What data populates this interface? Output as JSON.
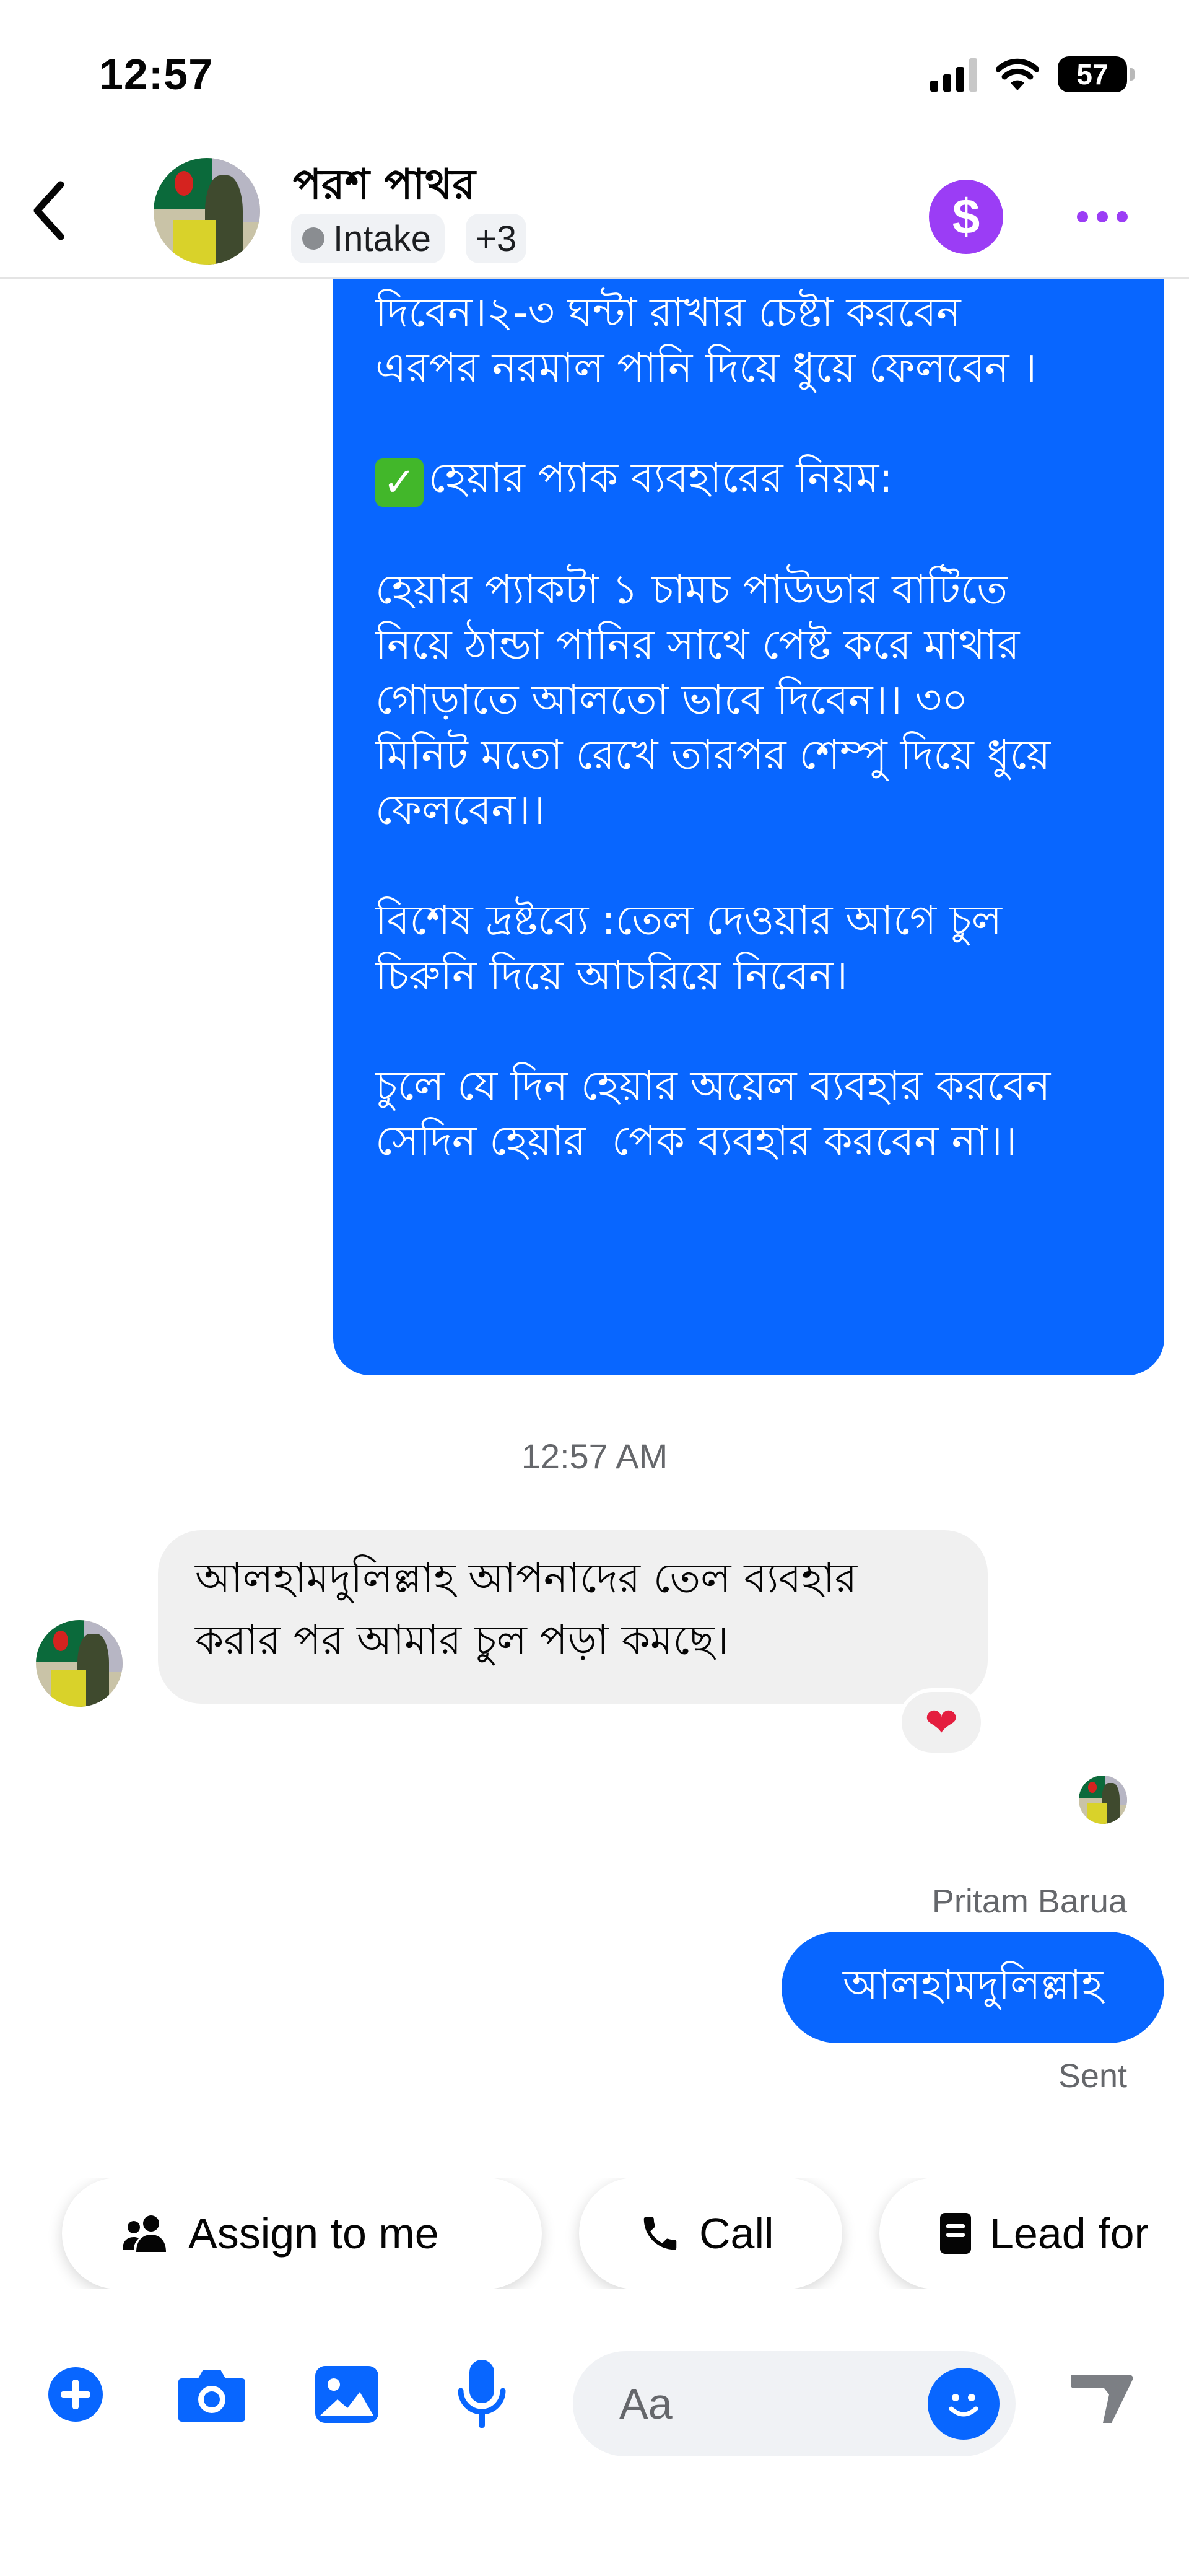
{
  "status_bar": {
    "time": "12:57",
    "battery": "57"
  },
  "header": {
    "contact_name": "পরশ পাথর",
    "label": "Intake",
    "more_labels": "+3",
    "payment_icon_glyph": "$"
  },
  "messages": {
    "outgoing_long_lines": [
      "দিবেন।২-৩ ঘন্টা রাখার চেষ্টা করবেন",
      "এরপর নরমাল পানি দিয়ে ধুয়ে ফেলবেন ।",
      "",
      "হেয়ার প্যাক ব্যবহারের নিয়ম:",
      "",
      "হেয়ার প্যাকটা ১ চামচ পাউডার বাটিতে",
      "নিয়ে ঠান্ডা পানির সাথে পেষ্ট করে মাথার",
      "গোড়াতে আলতো ভাবে দিবেন।। ৩০",
      "মিনিট মতো রেখে তারপর শেম্পু দিয়ে ধুয়ে",
      "ফেলবেন।।",
      "",
      "বিশেষ দ্রষ্টব্যে :তেল দেওয়ার আগে চুল",
      "চিরুনি দিয়ে আচরিয়ে নিবেন।",
      "",
      "চুলে যে দিন হেয়ার অয়েল ব্যবহার করবেন",
      "সেদিন হেয়ার  পেক ব্যবহার করবেন না।।"
    ],
    "timestamp": "12:57 AM",
    "incoming_text": "আলহামদুলিল্লাহ আপনাদের তেল ব্যবহার করার পর আমার চুল পড়া কমছে।",
    "reaction": "❤",
    "sender_name": "Pritam Barua",
    "outgoing_short": "আলহামদুলিল্লাহ",
    "sent_status": "Sent"
  },
  "quick_actions": {
    "assign": "Assign to me",
    "call": "Call",
    "lead": "Lead for"
  },
  "composer": {
    "placeholder": "Aa"
  },
  "colors": {
    "accent_blue": "#0866ff",
    "payment_purple": "#9b3df5",
    "bubble_gray": "#f0f0f0"
  }
}
